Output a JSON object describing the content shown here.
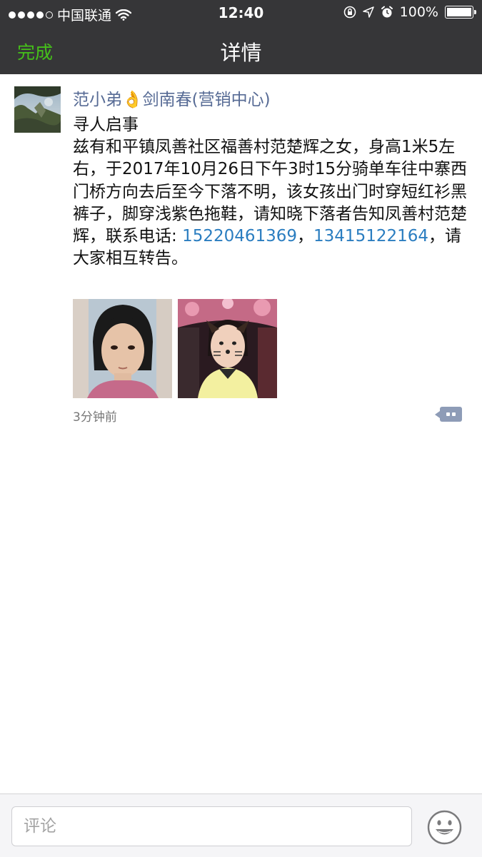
{
  "status_bar": {
    "carrier": "中国联通",
    "time": "12:40",
    "battery": "100%",
    "signal_bars": 4,
    "signal_total": 5,
    "battery_level": 1.0
  },
  "nav": {
    "done_label": "完成",
    "title": "详情"
  },
  "post": {
    "author_name": "范小弟",
    "author_emoji": "👌",
    "author_suffix": "剑南春(营销中心)",
    "title": "寻人启事",
    "body_text": "兹有和平镇凤善社区福善村范楚辉之女，身高1米5左右，于2017年10月26日下午3时15分骑单车往中寨西门桥方向去后至今下落不明，该女孩出门时穿短红衫黑裤子，脚穿浅紫色拖鞋，请知晓下落者告知凤善村范楚辉，联系电话: ",
    "phone_1": "15220461369",
    "separator": "，",
    "phone_2": "13415122164",
    "body_end": "，请大家相互转告。",
    "time_ago": "3分钟前"
  },
  "comment_bar": {
    "placeholder": "评论"
  },
  "colors": {
    "nav_bg": "#363638",
    "accent_green": "#45c01a",
    "author_blue": "#576b95",
    "link_blue": "#2a7dc0"
  }
}
